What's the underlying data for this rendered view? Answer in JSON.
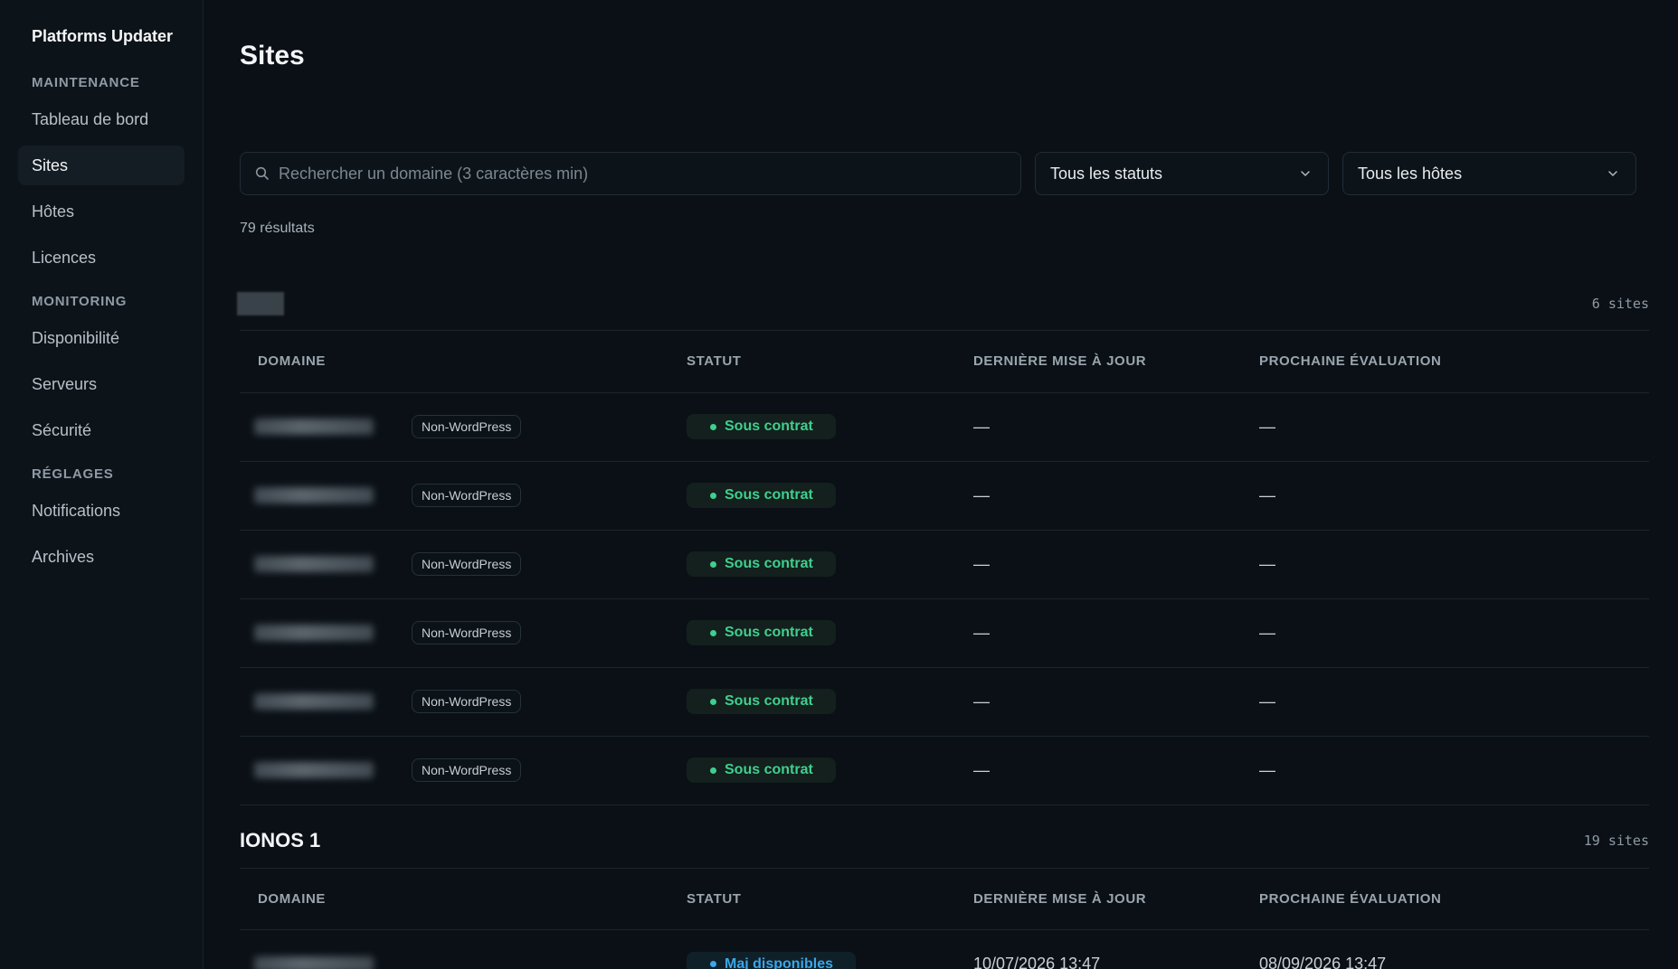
{
  "app": {
    "title": "Platforms Updater"
  },
  "sidebar": {
    "sections": [
      {
        "label": "MAINTENANCE",
        "items": [
          "Tableau de bord",
          "Sites",
          "Hôtes",
          "Licences"
        ]
      },
      {
        "label": "MONITORING",
        "items": [
          "Disponibilité",
          "Serveurs",
          "Sécurité"
        ]
      },
      {
        "label": "RÉGLAGES",
        "items": [
          "Notifications",
          "Archives"
        ]
      }
    ],
    "active": "Sites"
  },
  "page": {
    "title": "Sites"
  },
  "filters": {
    "search_placeholder": "Rechercher un domaine (3 caractères min)",
    "status_select": "Tous les statuts",
    "host_select": "Tous les hôtes"
  },
  "results": "79 résultats",
  "columns": [
    "DOMAINE",
    "STATUT",
    "DERNIÈRE MISE À JOUR",
    "PROCHAINE ÉVALUATION"
  ],
  "groups": [
    {
      "name": "",
      "count": "6 sites",
      "rows": [
        {
          "tag": "Non-WordPress",
          "status": "Sous contrat",
          "last": "—",
          "next": "—"
        },
        {
          "tag": "Non-WordPress",
          "status": "Sous contrat",
          "last": "—",
          "next": "—"
        },
        {
          "tag": "Non-WordPress",
          "status": "Sous contrat",
          "last": "—",
          "next": "—"
        },
        {
          "tag": "Non-WordPress",
          "status": "Sous contrat",
          "last": "—",
          "next": "—"
        },
        {
          "tag": "Non-WordPress",
          "status": "Sous contrat",
          "last": "—",
          "next": "—"
        },
        {
          "tag": "Non-WordPress",
          "status": "Sous contrat",
          "last": "—",
          "next": "—"
        }
      ]
    },
    {
      "name": "IONOS 1",
      "count": "19 sites",
      "rows": [
        {
          "tag": "",
          "status": "Maj disponibles",
          "last": "10/07/2026 13:47",
          "next": "08/09/2026 13:47"
        }
      ]
    }
  ],
  "colors": {
    "accent_green": "#3fcf8e",
    "accent_blue": "#3aa7e8",
    "background": "#0a1016"
  },
  "icons": {
    "search": "search-icon",
    "chevron": "chevron-down-icon"
  }
}
